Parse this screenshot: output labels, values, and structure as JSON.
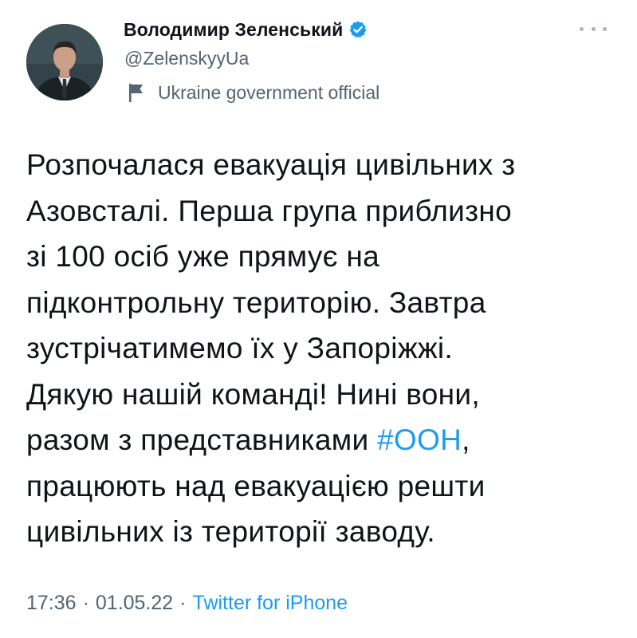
{
  "author": {
    "display_name": "Володимир Зеленський",
    "handle": "@ZelenskyyUa",
    "verified_icon": "verified-badge-icon",
    "label_icon": "flag-icon",
    "label": "Ukraine government official"
  },
  "tweet": {
    "lines": [
      "Розпочалася евакуація цивільних з",
      "Азовсталі. Перша група приблизно",
      "зі 100 осіб уже прямує на",
      "підконтрольну територію. Завтра",
      "зустрічатимемо їх у Запоріжжі.",
      "Дякую нашій команді! Нині вони,",
      "разом з представниками ",
      "працюють над евакуацією решти",
      "цивільних із території заводу."
    ],
    "hashtag": "#ООН",
    "after_hashtag": ","
  },
  "meta": {
    "time": "17:36",
    "separator": "·",
    "date": "01.05.22",
    "source": "Twitter for iPhone"
  },
  "colors": {
    "accent": "#1d9bf0",
    "secondary_text": "#536471",
    "primary_text": "#0f1419"
  }
}
